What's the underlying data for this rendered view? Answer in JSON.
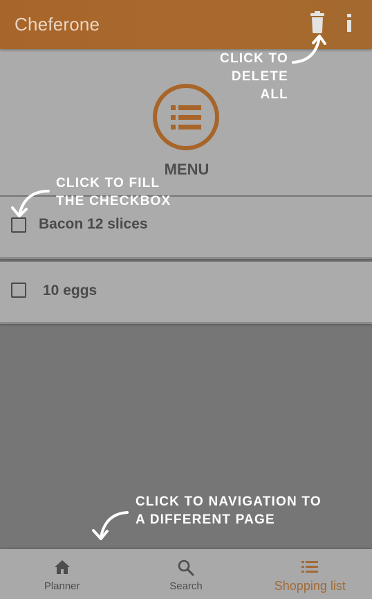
{
  "app_bar": {
    "title": "Cheferone",
    "delete_icon": "trash-icon",
    "info_icon": "info-icon",
    "info_glyph": "i"
  },
  "menu": {
    "label": "MENU",
    "icon": "list-icon"
  },
  "items": [
    {
      "label": "Bacon 12 slices",
      "checked": false
    },
    {
      "label": "10 eggs",
      "checked": false
    }
  ],
  "annotations": {
    "delete_line1": "CLICK TO",
    "delete_line2": "DELETE ALL",
    "checkbox_line1": "CLICK TO FILL",
    "checkbox_line2": "THE CHECKBOX",
    "nav_line1": "CLICK TO NAVIGATION TO",
    "nav_line2": "A DIFFERENT PAGE"
  },
  "bottom_nav": {
    "items": [
      {
        "label": "Planner",
        "icon": "home-icon",
        "active": false
      },
      {
        "label": "Search",
        "icon": "search-icon",
        "active": false
      },
      {
        "label": "Shopping list",
        "icon": "list-icon",
        "active": true
      }
    ]
  },
  "colors": {
    "accent": "#a8652a",
    "overlay_gray": "#ababab",
    "annotation": "#ffffff"
  }
}
